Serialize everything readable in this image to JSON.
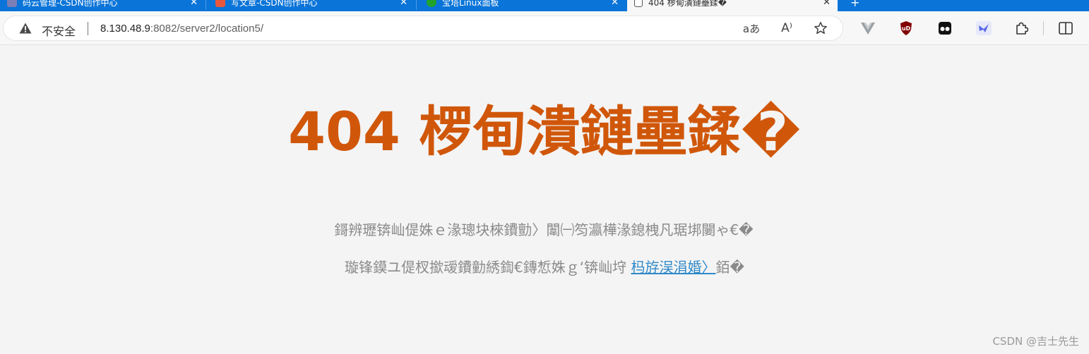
{
  "tabs": [
    {
      "title": "码云管理-CSDN创作中心",
      "active": false,
      "favicon_color": "#7a7fb5"
    },
    {
      "title": "写文章-CSDN创作中心",
      "active": false,
      "favicon_color": "#e8573c"
    },
    {
      "title": "宝塔Linux面板",
      "active": false,
      "favicon_color": "#21a32b"
    },
    {
      "title": "404 椤甸潰鏈壘鍒�",
      "active": true,
      "favicon_color": "#ffffff"
    }
  ],
  "addressbar": {
    "security_label": "不安全",
    "url_host": "8.130.48.9",
    "url_rest": ":8082/server2/location5/",
    "read_aloud_icon": "a͏ᷓ",
    "translate_label": "aあ",
    "read_label": "A⁾"
  },
  "colors": {
    "title": "#d0570a",
    "text": "#8a8a8a",
    "link": "#2f89c9",
    "tabstrip": "#0a74d8"
  },
  "page": {
    "title": "404 椤甸潰鏈壘鍒�",
    "line1": "鎶辨瓑锛屾偍姝ｅ湪璁块棶鐨勯〉闈㈠笉瀛樺湪鎴栧凡琚垹闄ゃ€�",
    "line2_prefix": "璇锋鏌ユ偍杈撳叆鐨勭綉鍧€鏄惁姝ｇ‘锛屾垨",
    "line2_link": "杩斿洖涓婚〉",
    "line2_suffix": "銆�"
  },
  "watermark": "CSDN @吉士先生"
}
